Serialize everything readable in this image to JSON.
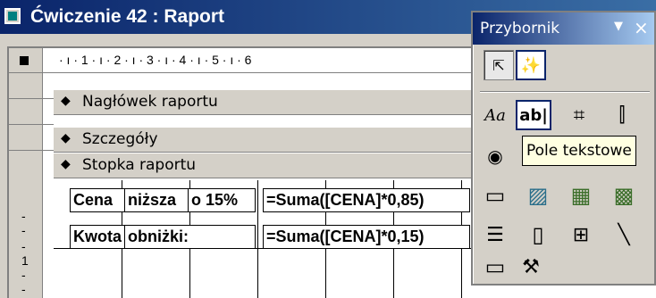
{
  "window": {
    "title": "Ćwiczenie 42 : Raport"
  },
  "ruler": {
    "marks": "· ı · 1 · ı · 2 · ı · 3 · ı · 4 · ı · 5 · ı · 6",
    "vertical": [
      "-",
      "-",
      "-",
      "1",
      "-",
      "-"
    ]
  },
  "sections": [
    {
      "label": "Nagłówek raportu"
    },
    {
      "label": "Szczegóły"
    },
    {
      "label": "Stopka raportu"
    }
  ],
  "footer_controls": {
    "row1": {
      "label_a": "Cena",
      "label_b": "niższa",
      "label_c": "o 15%",
      "expr": "=Suma([CENA]*0,85)"
    },
    "row2": {
      "label_a": "Kwota",
      "label_b": "obniżki:",
      "expr": "=Suma([CENA]*0,15)"
    }
  },
  "toolbox": {
    "title": "Przybornik",
    "tooltip": "Pole tekstowe",
    "tools": [
      {
        "icon": "select-objects-icon",
        "glyph": "⇱"
      },
      {
        "icon": "control-wizards-icon",
        "glyph": "✨"
      },
      {
        "icon": "label-icon",
        "glyph": "Aa"
      },
      {
        "icon": "text-box-icon",
        "glyph": "ab|"
      },
      {
        "icon": "option-group-icon",
        "glyph": "⌗"
      },
      {
        "icon": "toggle-button-icon",
        "glyph": "⫿"
      },
      {
        "icon": "option-button-icon",
        "glyph": "◉"
      },
      {
        "icon": "command-button-icon",
        "glyph": "▭"
      },
      {
        "icon": "image-icon",
        "glyph": "▨"
      },
      {
        "icon": "unbound-object-frame-icon",
        "glyph": "▦"
      },
      {
        "icon": "bound-object-frame-icon",
        "glyph": "▩"
      },
      {
        "icon": "page-break-icon",
        "glyph": "☰"
      },
      {
        "icon": "tab-control-icon",
        "glyph": "▯"
      },
      {
        "icon": "subform-icon",
        "glyph": "⊞"
      },
      {
        "icon": "line-icon",
        "glyph": "╲"
      },
      {
        "icon": "rectangle-icon",
        "glyph": "▭"
      },
      {
        "icon": "more-controls-icon",
        "glyph": "⚒"
      }
    ]
  }
}
